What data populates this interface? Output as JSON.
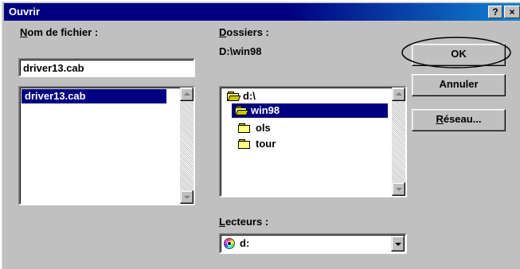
{
  "window": {
    "title": "Ouvrir",
    "help_label": "?",
    "close_label": "×"
  },
  "file_name": {
    "label_accel": "N",
    "label_rest": "om de fichier :",
    "value": "driver13.cab",
    "list": [
      "driver13.cab"
    ]
  },
  "folders": {
    "label_accel": "D",
    "label_rest": "ossiers :",
    "current_path": "D:\\win98",
    "tree": [
      {
        "label": "d:\\",
        "icon": "open-folder-icon"
      },
      {
        "label": "win98",
        "icon": "open-folder-icon",
        "selected": true
      },
      {
        "label": "ols",
        "icon": "folder-icon"
      },
      {
        "label": "tour",
        "icon": "folder-icon"
      }
    ]
  },
  "drives": {
    "label_accel": "L",
    "label_rest": "ecteurs :",
    "value": "d:",
    "icon": "cd-drive-icon"
  },
  "buttons": {
    "ok": "OK",
    "cancel": "Annuler",
    "network_accel": "R",
    "network_rest": "éseau..."
  },
  "annotation": {
    "color": "#000000",
    "shape": "ellipse around OK button"
  }
}
